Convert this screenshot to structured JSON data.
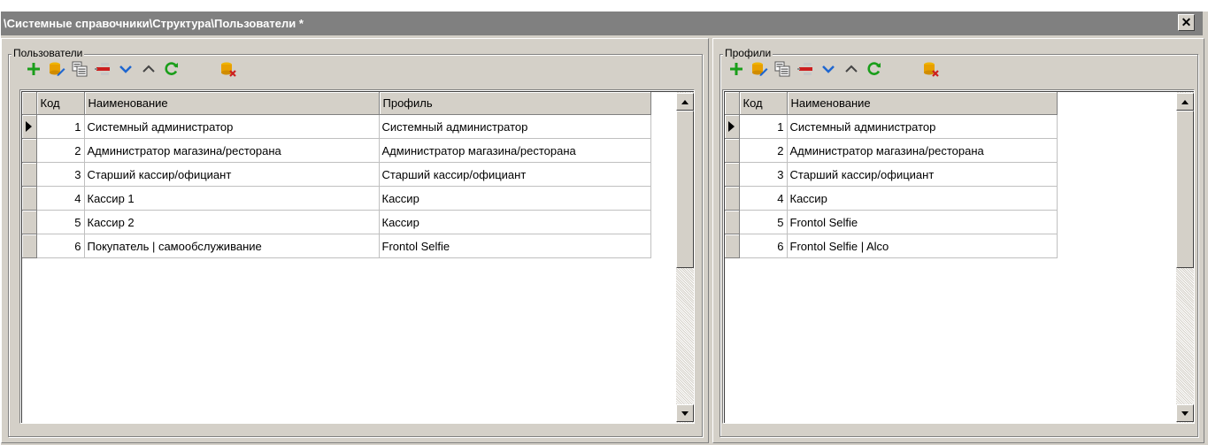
{
  "window": {
    "title": "\\Системные справочники\\Структура\\Пользователи *",
    "close_glyph": "✕"
  },
  "users_panel": {
    "label": "Пользователи",
    "columns": {
      "code": "Код",
      "name": "Наименование",
      "profile": "Профиль"
    },
    "rows": [
      {
        "code": "1",
        "name": "Системный администратор",
        "profile": "Системный администратор"
      },
      {
        "code": "2",
        "name": "Администратор магазина/ресторана",
        "profile": "Администратор магазина/ресторана"
      },
      {
        "code": "3",
        "name": "Старший кассир/официант",
        "profile": "Старший кассир/официант"
      },
      {
        "code": "4",
        "name": "Кассир 1",
        "profile": "Кассир"
      },
      {
        "code": "5",
        "name": "Кассир 2",
        "profile": "Кассир"
      },
      {
        "code": "6",
        "name": "Покупатель | самообслуживание",
        "profile": "Frontol Selfie"
      }
    ]
  },
  "profiles_panel": {
    "label": "Профили",
    "columns": {
      "code": "Код",
      "name": "Наименование"
    },
    "rows": [
      {
        "code": "1",
        "name": "Системный администратор"
      },
      {
        "code": "2",
        "name": "Администратор магазина/ресторана"
      },
      {
        "code": "3",
        "name": "Старший кассир/официант"
      },
      {
        "code": "4",
        "name": "Кассир"
      },
      {
        "code": "5",
        "name": "Frontol Selfie"
      },
      {
        "code": "6",
        "name": "Frontol Selfie | Alco"
      }
    ]
  },
  "toolbar_icons": [
    "add-icon",
    "edit-icon",
    "copy-icon",
    "delete-icon",
    "move-down-icon",
    "move-up-icon",
    "refresh-icon",
    "clear-icon"
  ],
  "colors": {
    "add": "#1a9e1a",
    "edit": "#e8a000",
    "delete": "#cc1f1f",
    "move": "#1e66d0",
    "refresh": "#1a9e1a",
    "title_bar": "#808080"
  }
}
